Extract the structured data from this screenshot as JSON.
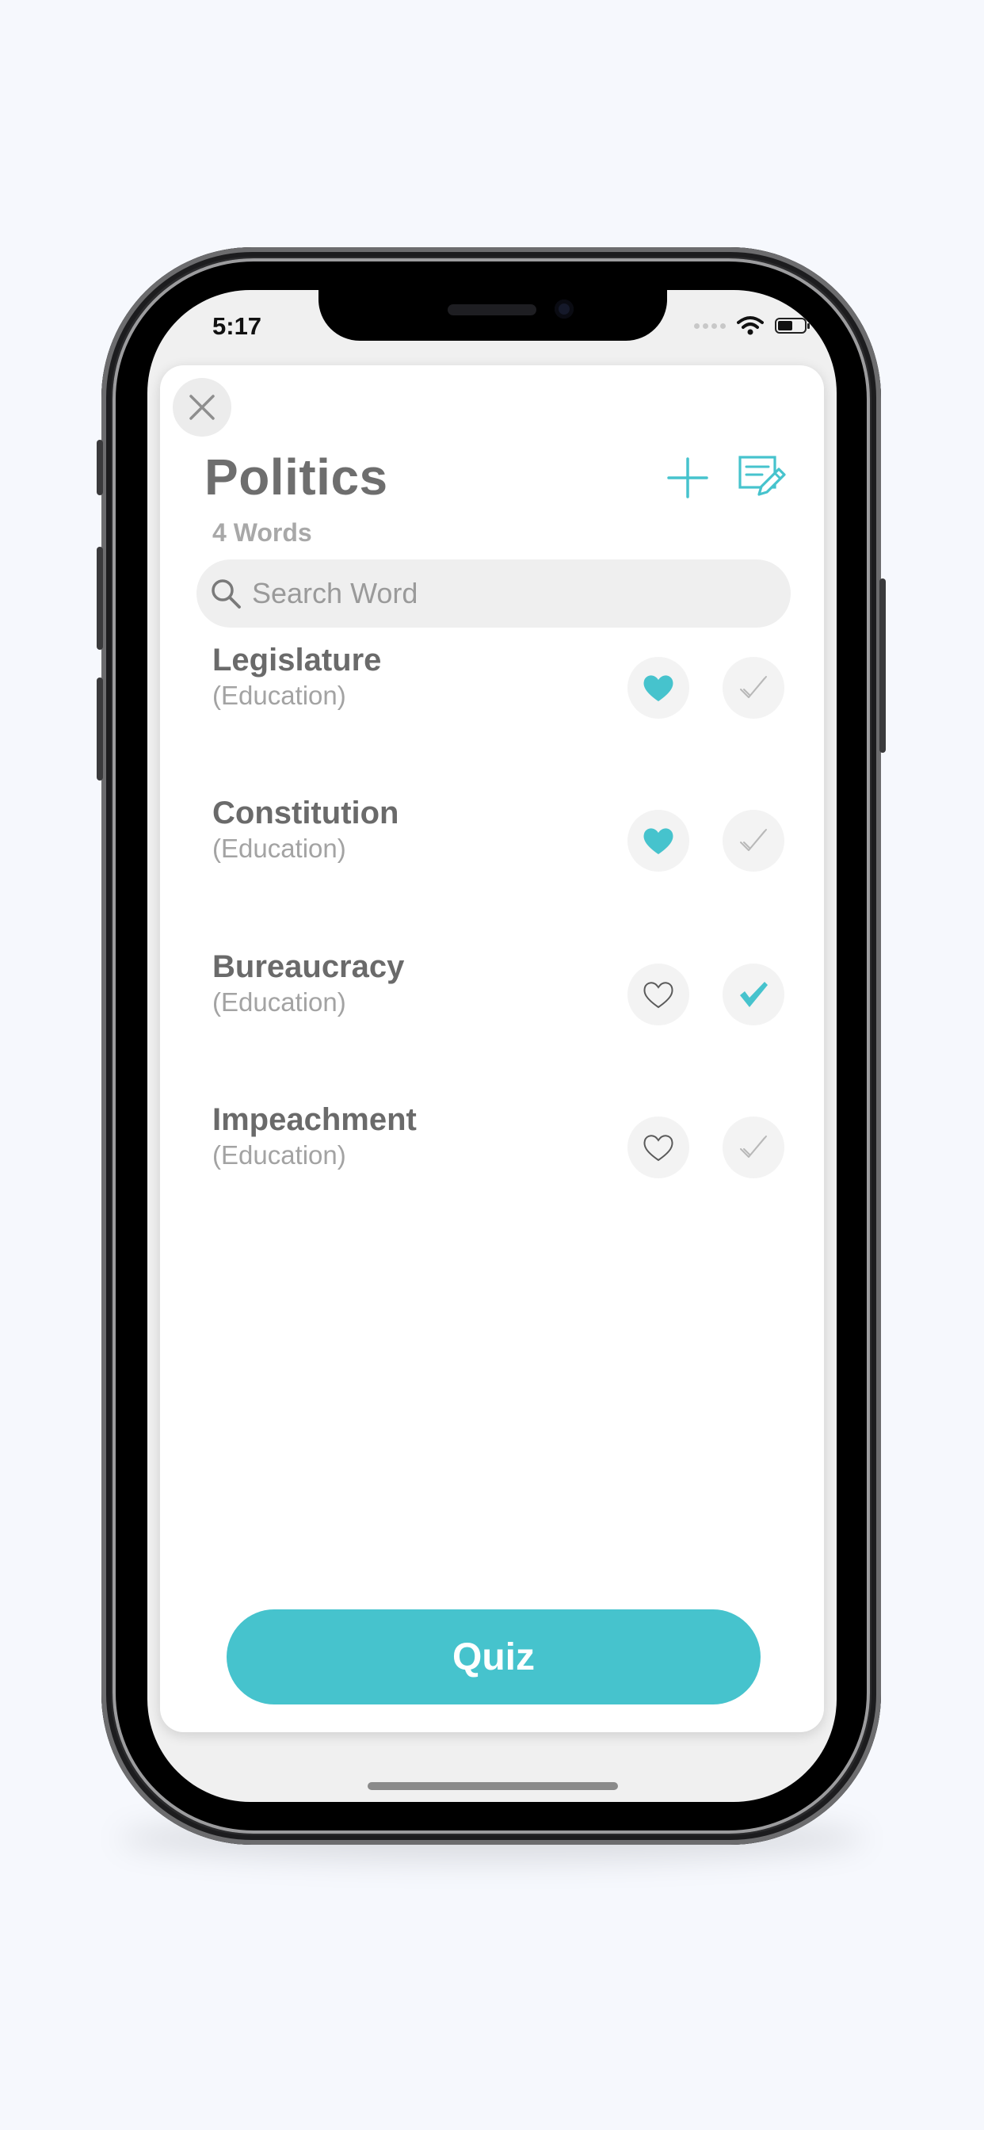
{
  "status_bar": {
    "time": "5:17"
  },
  "header": {
    "title": "Politics",
    "word_count": "4 Words",
    "add_icon": "plus-icon",
    "edit_icon": "edit-list-icon",
    "close_icon": "close-icon"
  },
  "search": {
    "placeholder": "Search Word",
    "value": ""
  },
  "words": [
    {
      "word": "Legislature",
      "category": "(Education)",
      "favorite": true,
      "learned": false
    },
    {
      "word": "Constitution",
      "category": "(Education)",
      "favorite": true,
      "learned": false
    },
    {
      "word": "Bureaucracy",
      "category": "(Education)",
      "favorite": false,
      "learned": true
    },
    {
      "word": "Impeachment",
      "category": "(Education)",
      "favorite": false,
      "learned": false
    }
  ],
  "quiz_button": {
    "label": "Quiz"
  },
  "colors": {
    "accent": "#46c3cd",
    "text_primary": "#6a6a6a",
    "text_secondary": "#a3a3a3"
  }
}
